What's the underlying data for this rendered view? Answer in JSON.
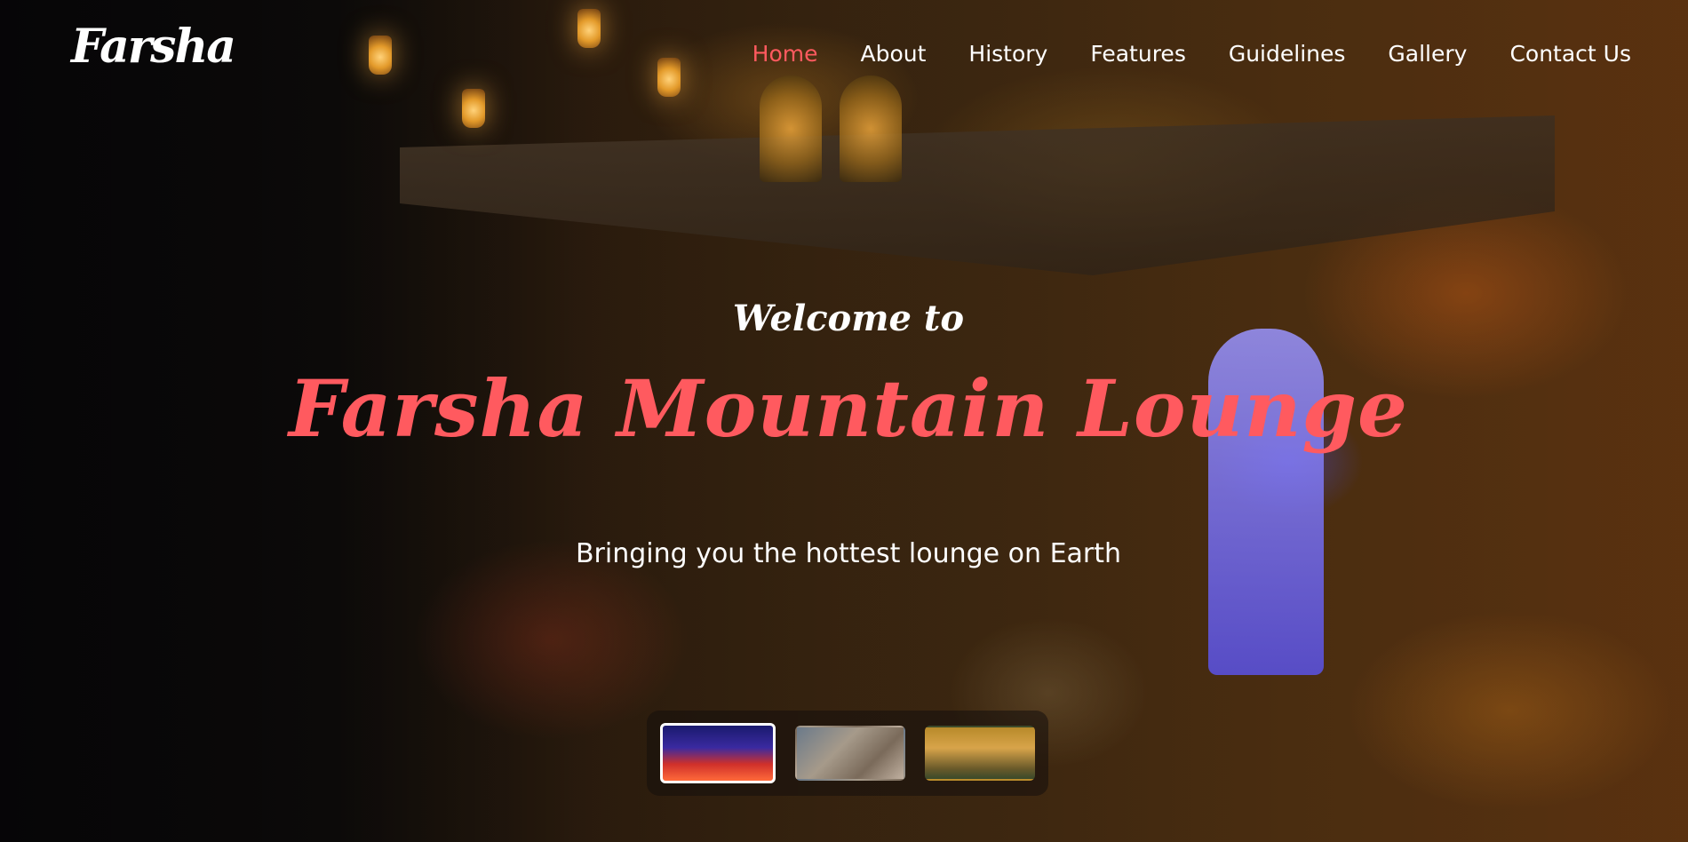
{
  "brand": {
    "logo_text": "Farsha"
  },
  "nav": {
    "items": [
      {
        "label": "Home",
        "active": true
      },
      {
        "label": "About",
        "active": false
      },
      {
        "label": "History",
        "active": false
      },
      {
        "label": "Features",
        "active": false
      },
      {
        "label": "Guidelines",
        "active": false
      },
      {
        "label": "Gallery",
        "active": false
      },
      {
        "label": "Contact Us",
        "active": false
      }
    ]
  },
  "hero": {
    "welcome": "Welcome to",
    "title": "Farsha Mountain Lounge",
    "subtitle": "Bringing you the hottest lounge on Earth"
  },
  "slider": {
    "active_index": 0,
    "thumbnail_count": 3
  },
  "colors": {
    "accent": "#ff5a5f",
    "text": "#ffffff",
    "thumb_bar_bg": "#140e0c"
  }
}
